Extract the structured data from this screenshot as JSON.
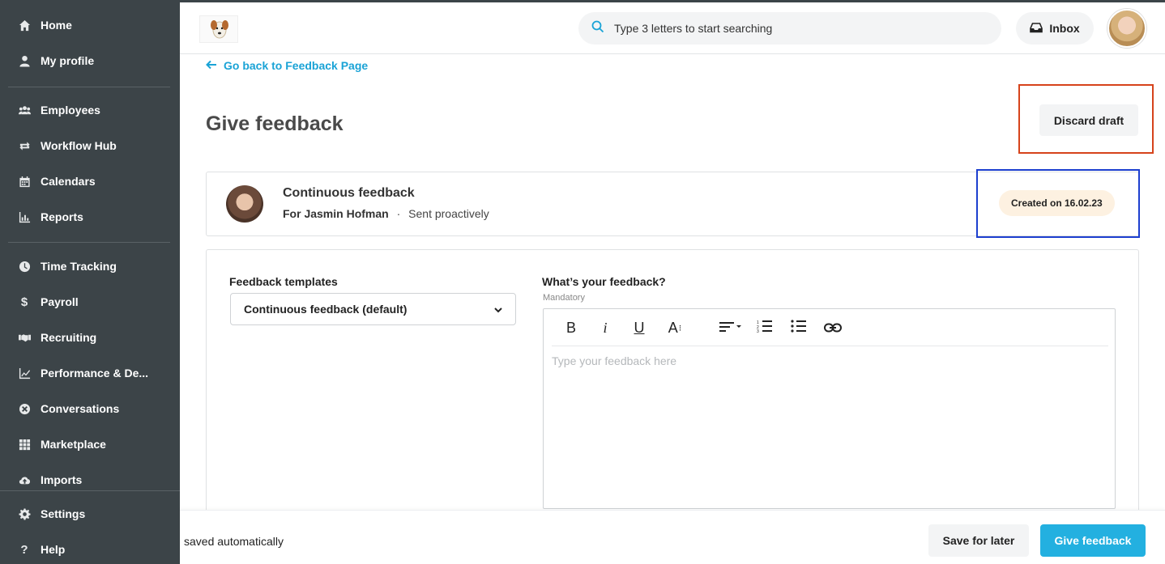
{
  "sidebar": {
    "items": [
      {
        "label": "Home",
        "icon": "home-icon"
      },
      {
        "label": "My profile",
        "icon": "user-icon"
      },
      {
        "label": "Employees",
        "icon": "people-icon"
      },
      {
        "label": "Workflow Hub",
        "icon": "repeat-icon"
      },
      {
        "label": "Calendars",
        "icon": "calendar-icon"
      },
      {
        "label": "Reports",
        "icon": "bar-chart-icon"
      },
      {
        "label": "Time Tracking",
        "icon": "clock-icon"
      },
      {
        "label": "Payroll",
        "icon": "dollar-icon"
      },
      {
        "label": "Recruiting",
        "icon": "handshake-icon"
      },
      {
        "label": "Performance & De...",
        "icon": "line-chart-icon"
      },
      {
        "label": "Conversations",
        "icon": "conversation-icon"
      },
      {
        "label": "Marketplace",
        "icon": "grid-icon"
      },
      {
        "label": "Imports",
        "icon": "cloud-upload-icon"
      }
    ],
    "bottom_items": [
      {
        "label": "Settings",
        "icon": "gear-icon"
      },
      {
        "label": "Help",
        "icon": "question-icon"
      }
    ]
  },
  "header": {
    "search_placeholder": "Type 3 letters to start searching",
    "inbox_label": "Inbox"
  },
  "main": {
    "back_link": "Go back to Feedback Page",
    "page_title": "Give feedback",
    "discard_label": "Discard draft",
    "card": {
      "title": "Continuous feedback",
      "recipient": "For Jasmin Hofman",
      "separator": "·",
      "status": "Sent proactively",
      "created_badge": "Created on 16.02.23"
    },
    "form": {
      "templates_label": "Feedback templates",
      "template_selected": "Continuous feedback (default)",
      "feedback_label": "What’s your feedback?",
      "mandatory_label": "Mandatory",
      "feedback_placeholder": "Type your feedback here",
      "toolbar": {
        "bold": "B",
        "italic": "i",
        "underline": "U",
        "font_size": "A"
      }
    }
  },
  "footer": {
    "saved_text": "saved automatically",
    "save_later_label": "Save for later",
    "give_feedback_label": "Give feedback"
  },
  "colors": {
    "sidebar_bg": "#3c4448",
    "accent": "#23b0e0",
    "link": "#1aa3d6",
    "badge_bg": "#fdf1e1",
    "highlight_red": "#d6431b",
    "highlight_blue": "#1d3fcf"
  }
}
